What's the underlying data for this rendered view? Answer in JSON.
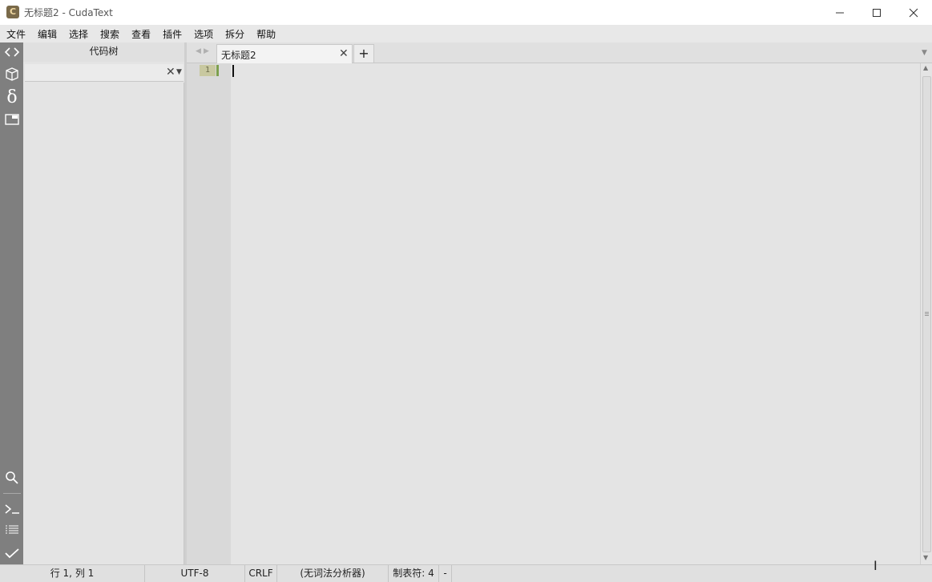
{
  "window": {
    "title": "无标题2 - CudaText",
    "app_icon_letter": "C"
  },
  "menu": [
    "文件",
    "编辑",
    "选择",
    "搜索",
    "查看",
    "插件",
    "选项",
    "拆分",
    "帮助"
  ],
  "panel": {
    "title": "代码树",
    "filter_placeholder": ""
  },
  "tabs": [
    {
      "label": "无标题2",
      "active": true
    }
  ],
  "editor": {
    "line_numbers": [
      "1"
    ],
    "content": ""
  },
  "statusbar": {
    "position": "行 1, 列 1",
    "encoding": "UTF-8",
    "line_ending": "CRLF",
    "lexer": "(无词法分析器)",
    "tab_size": "制表符: 4",
    "extra": "-"
  },
  "colors": {
    "sidebar": "#7f7f7f",
    "editor_bg": "#e4e4e4",
    "gutter_bg": "#d9d9d9",
    "current_line_marker": "#7da04d"
  },
  "icons": {
    "sidebar_top": [
      "code-toggle-icon",
      "cube-icon",
      "delta-icon",
      "window-icon"
    ],
    "sidebar_bottom": [
      "search-icon",
      "terminal-icon",
      "list-icon",
      "check-icon"
    ]
  }
}
